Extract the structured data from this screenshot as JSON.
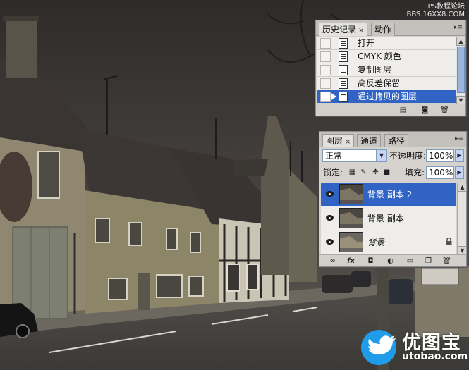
{
  "watermark_top": {
    "line1": "PS教程论坛",
    "line2": "BBS.16XX8.COM"
  },
  "watermark_logo": {
    "cn": "优图宝",
    "en": "utobao.com"
  },
  "history_panel": {
    "tabs": [
      {
        "label": "历史记录",
        "active": true,
        "close": "×"
      },
      {
        "label": "动作",
        "active": false
      }
    ],
    "items": [
      {
        "label": "打开",
        "selected": false
      },
      {
        "label": "CMYK 颜色",
        "selected": false
      },
      {
        "label": "复制图层",
        "selected": false
      },
      {
        "label": "高反差保留",
        "selected": false
      },
      {
        "label": "通过拷贝的图层",
        "selected": true
      }
    ],
    "footer_icons": [
      "new-document-from-state-icon",
      "new-snapshot-icon",
      "trash-icon"
    ]
  },
  "layers_panel": {
    "tabs": [
      {
        "label": "图层",
        "active": true,
        "close": "×"
      },
      {
        "label": "通道",
        "active": false
      },
      {
        "label": "路径",
        "active": false
      }
    ],
    "blend_mode": "正常",
    "opacity_label": "不透明度:",
    "opacity_value": "100%",
    "lock_label": "锁定:",
    "fill_label": "填充:",
    "fill_value": "100%",
    "layers": [
      {
        "name": "背景 副本 2",
        "selected": true,
        "visible": true,
        "locked": false,
        "italic": false
      },
      {
        "name": "背景 副本",
        "selected": false,
        "visible": true,
        "locked": false,
        "italic": false
      },
      {
        "name": "背景",
        "selected": false,
        "visible": true,
        "locked": true,
        "italic": true
      }
    ],
    "footer_icons": [
      "link-icon",
      "fx-icon",
      "mask-icon",
      "adjustment-icon",
      "group-folder-icon",
      "new-layer-icon",
      "trash-icon"
    ],
    "fx_label": "fx"
  },
  "colors": {
    "selection": "#3163c5",
    "panel_bg": "#d6d3ce",
    "sky": "#3d3937",
    "stone": "#8a8266"
  }
}
